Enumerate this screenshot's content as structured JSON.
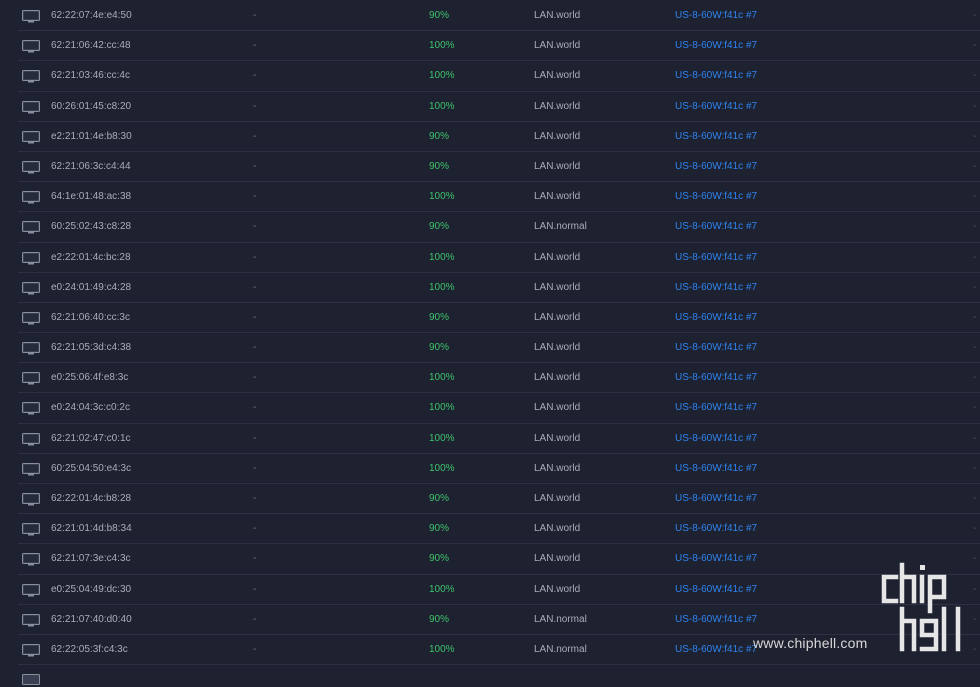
{
  "colors": {
    "background": "#1e2130",
    "row_divider": "#2c3042",
    "text_primary": "#a9adb9",
    "text_muted": "#6f7485",
    "experience_green": "#3dc46b",
    "link_blue": "#2f84f0"
  },
  "device_icon": "monitor-icon",
  "rows": [
    {
      "mac": "62:22:07:4e:e4:50",
      "name": "-",
      "experience": "90%",
      "network": "LAN.world",
      "uplink": "US-8-60W:f41c #7",
      "trailing": "-"
    },
    {
      "mac": "62:21:06:42:cc:48",
      "name": "-",
      "experience": "100%",
      "network": "LAN.world",
      "uplink": "US-8-60W:f41c #7",
      "trailing": "-"
    },
    {
      "mac": "62:21:03:46:cc:4c",
      "name": "-",
      "experience": "100%",
      "network": "LAN.world",
      "uplink": "US-8-60W:f41c #7",
      "trailing": "-"
    },
    {
      "mac": "60:26:01:45:c8:20",
      "name": "-",
      "experience": "100%",
      "network": "LAN.world",
      "uplink": "US-8-60W:f41c #7",
      "trailing": "-"
    },
    {
      "mac": "e2:21:01:4e:b8:30",
      "name": "-",
      "experience": "90%",
      "network": "LAN.world",
      "uplink": "US-8-60W:f41c #7",
      "trailing": "-"
    },
    {
      "mac": "62:21:06:3c:c4:44",
      "name": "-",
      "experience": "90%",
      "network": "LAN.world",
      "uplink": "US-8-60W:f41c #7",
      "trailing": "-"
    },
    {
      "mac": "64:1e:01:48:ac:38",
      "name": "-",
      "experience": "100%",
      "network": "LAN.world",
      "uplink": "US-8-60W:f41c #7",
      "trailing": "-"
    },
    {
      "mac": "60:25:02:43:c8:28",
      "name": "-",
      "experience": "90%",
      "network": "LAN.normal",
      "uplink": "US-8-60W:f41c #7",
      "trailing": "-"
    },
    {
      "mac": "e2:22:01:4c:bc:28",
      "name": "-",
      "experience": "100%",
      "network": "LAN.world",
      "uplink": "US-8-60W:f41c #7",
      "trailing": "-"
    },
    {
      "mac": "e0:24:01:49:c4:28",
      "name": "-",
      "experience": "100%",
      "network": "LAN.world",
      "uplink": "US-8-60W:f41c #7",
      "trailing": "-"
    },
    {
      "mac": "62:21:06:40:cc:3c",
      "name": "-",
      "experience": "90%",
      "network": "LAN.world",
      "uplink": "US-8-60W:f41c #7",
      "trailing": "-"
    },
    {
      "mac": "62:21:05:3d:c4:38",
      "name": "-",
      "experience": "90%",
      "network": "LAN.world",
      "uplink": "US-8-60W:f41c #7",
      "trailing": "-"
    },
    {
      "mac": "e0:25:06:4f:e8:3c",
      "name": "-",
      "experience": "100%",
      "network": "LAN.world",
      "uplink": "US-8-60W:f41c #7",
      "trailing": "-"
    },
    {
      "mac": "e0:24:04:3c:c0:2c",
      "name": "-",
      "experience": "100%",
      "network": "LAN.world",
      "uplink": "US-8-60W:f41c #7",
      "trailing": "-"
    },
    {
      "mac": "62:21:02:47:c0:1c",
      "name": "-",
      "experience": "100%",
      "network": "LAN.world",
      "uplink": "US-8-60W:f41c #7",
      "trailing": "-"
    },
    {
      "mac": "60:25:04:50:e4:3c",
      "name": "-",
      "experience": "100%",
      "network": "LAN.world",
      "uplink": "US-8-60W:f41c #7",
      "trailing": "-"
    },
    {
      "mac": "62:22:01:4c:b8:28",
      "name": "-",
      "experience": "90%",
      "network": "LAN.world",
      "uplink": "US-8-60W:f41c #7",
      "trailing": "-"
    },
    {
      "mac": "62:21:01:4d:b8:34",
      "name": "-",
      "experience": "90%",
      "network": "LAN.world",
      "uplink": "US-8-60W:f41c #7",
      "trailing": "-"
    },
    {
      "mac": "62:21:07:3e:c4:3c",
      "name": "-",
      "experience": "90%",
      "network": "LAN.world",
      "uplink": "US-8-60W:f41c #7",
      "trailing": "-"
    },
    {
      "mac": "e0:25:04:49:dc:30",
      "name": "-",
      "experience": "100%",
      "network": "LAN.world",
      "uplink": "US-8-60W:f41c #7",
      "trailing": "-"
    },
    {
      "mac": "62:21:07:40:d0:40",
      "name": "-",
      "experience": "90%",
      "network": "LAN.normal",
      "uplink": "US-8-60W:f41c #7",
      "trailing": "-"
    },
    {
      "mac": "62:22:05:3f:c4:3c",
      "name": "-",
      "experience": "100%",
      "network": "LAN.normal",
      "uplink": "US-8-60W:f41c #7",
      "trailing": "-"
    }
  ],
  "watermark": {
    "logo_text": "chip hell",
    "url": "www.chiphell.com"
  }
}
